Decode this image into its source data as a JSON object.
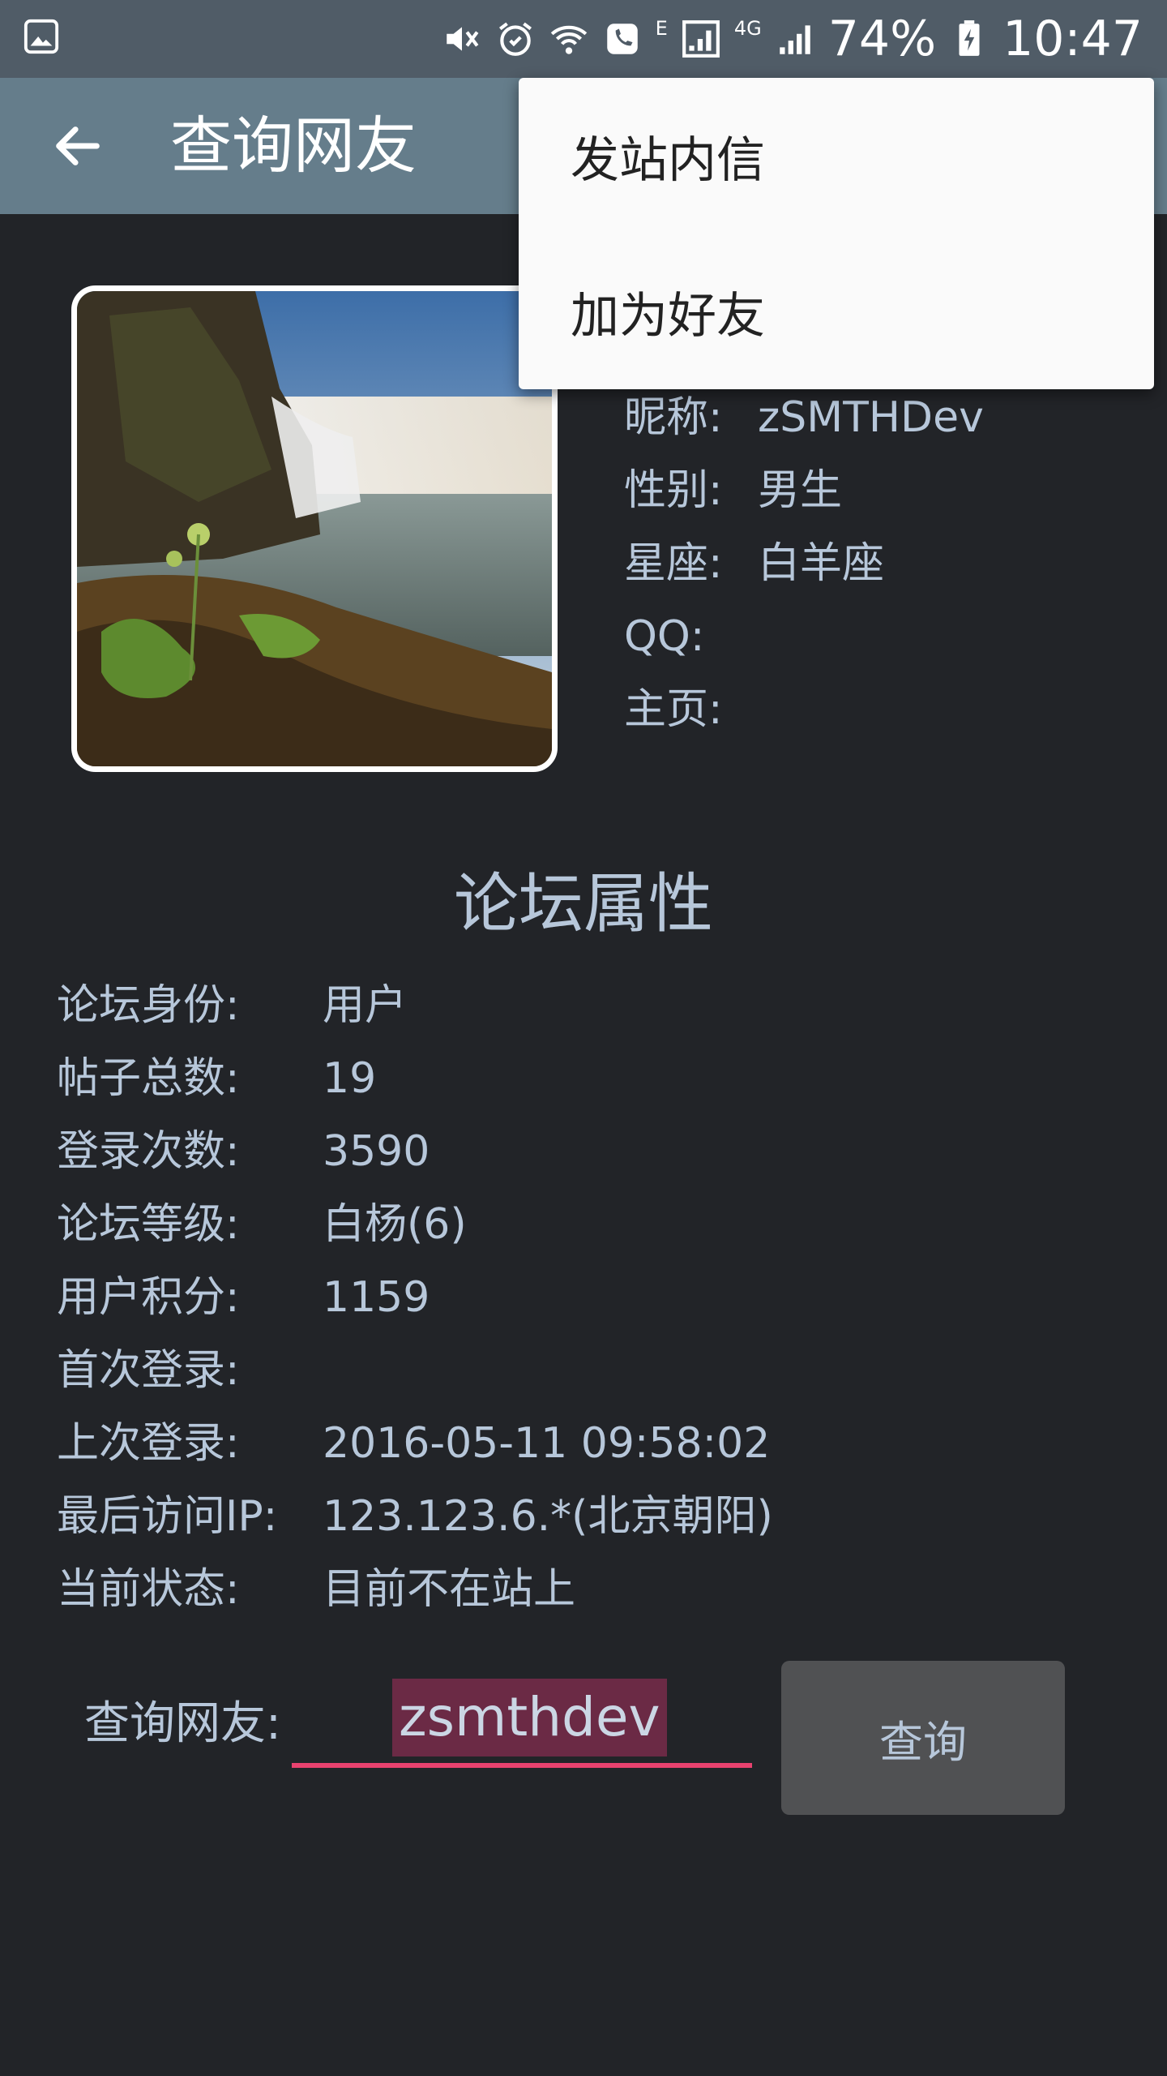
{
  "status_bar": {
    "battery": "74%",
    "time": "10:47",
    "edge_tag": "E",
    "lte_tag": "4G",
    "icons": [
      "gallery-icon",
      "mute-icon",
      "alarm-icon",
      "wifi-icon",
      "call-icon",
      "signal-icon",
      "battery-icon"
    ]
  },
  "appbar": {
    "title": "查询网友",
    "back_icon": "arrow-left-icon"
  },
  "menu": {
    "items": [
      {
        "label": "发站内信"
      },
      {
        "label": "加为好友"
      }
    ]
  },
  "profile": {
    "fields": [
      {
        "label": "昵称:",
        "value": "zSMTHDev"
      },
      {
        "label": "性别:",
        "value": "男生"
      },
      {
        "label": "星座:",
        "value": "白羊座"
      },
      {
        "label": "QQ:",
        "value": ""
      },
      {
        "label": "主页:",
        "value": ""
      }
    ]
  },
  "forum": {
    "title": "论坛属性",
    "rows": [
      {
        "label": "论坛身份:",
        "value": "用户"
      },
      {
        "label": "帖子总数:",
        "value": "19"
      },
      {
        "label": "登录次数:",
        "value": "3590"
      },
      {
        "label": "论坛等级:",
        "value": "白杨(6)"
      },
      {
        "label": "用户积分:",
        "value": "1159"
      },
      {
        "label": "首次登录:",
        "value": ""
      },
      {
        "label": "上次登录:",
        "value": "2016-05-11 09:58:02"
      },
      {
        "label": "最后访问IP:",
        "value": "123.123.6.*(北京朝阳)"
      },
      {
        "label": "当前状态:",
        "value": "目前不在站上"
      }
    ]
  },
  "search": {
    "label": "查询网友:",
    "value": "zsmthdev",
    "button": "查询",
    "accent": "#e9426f"
  },
  "colors": {
    "background": "#222428",
    "appbar": "#657d8b",
    "statusbar": "#505c67",
    "text": "#b7c7da"
  }
}
